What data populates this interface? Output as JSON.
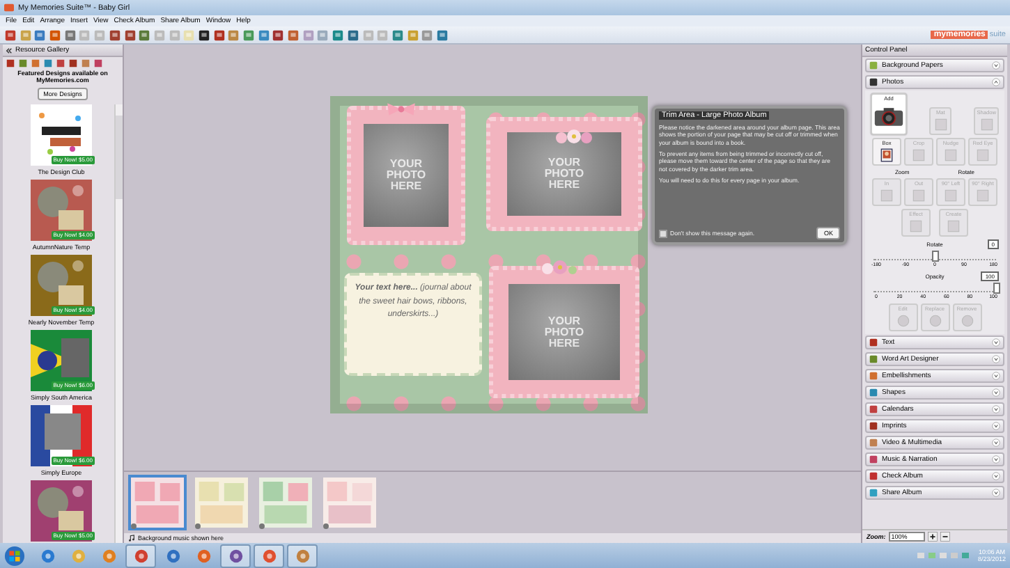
{
  "window": {
    "title": "My Memories Suite™ - Baby Girl"
  },
  "menu": [
    "File",
    "Edit",
    "Arrange",
    "Insert",
    "View",
    "Check Album",
    "Share Album",
    "Window",
    "Help"
  ],
  "logo": {
    "name": "mymemories",
    "suffix": "suite"
  },
  "gallery": {
    "title": "Resource Gallery",
    "featured": "Featured Designs available on MyMemories.com",
    "more_button": "More Designs",
    "items": [
      {
        "name": "The Design Club",
        "price": "Buy Now! $5.00"
      },
      {
        "name": "AutumnNature Temp",
        "price": "Buy Now! $4.00"
      },
      {
        "name": "Nearly November Temp",
        "price": "Buy Now! $4.00"
      },
      {
        "name": "Simply South America",
        "price": "Buy Now! $6.00"
      },
      {
        "name": "Simply Europe",
        "price": "Buy Now! $6.00"
      },
      {
        "price": "Buy Now! $5.00"
      }
    ]
  },
  "page": {
    "photo_placeholders": [
      "YOUR PHOTO HERE",
      "YOUR PHOTO HERE",
      "YOUR PHOTO HERE"
    ],
    "text_box": "**Your text here...** (journal about the sweet hair bows, ribbons, underskirts...)"
  },
  "dialog": {
    "title": "Trim Area - Large Photo Album",
    "paragraphs": [
      "Please notice the darkened area around your album page. This area shows the portion of your page that may be cut off or trimmed when your album is bound into a book.",
      "To prevent any items from being trimmed or incorrectly cut off, please move them toward the center of the page so that they are not covered by the darker trim area.",
      "You will need to do this for every page in your album."
    ],
    "checkbox": {
      "label": "Don't show this message again.",
      "checked": false
    },
    "ok_button": "OK"
  },
  "thumbnails": [
    {
      "selected": true
    },
    {
      "selected": false
    },
    {
      "selected": false
    },
    {
      "selected": false
    }
  ],
  "music_bar": "Background music shown here",
  "control_panel": {
    "title": "Control Panel",
    "top_sections": [
      {
        "label": "Background Papers",
        "expanded": false
      },
      {
        "label": "Photos",
        "expanded": true
      }
    ],
    "tool_rows": [
      {
        "buttons": [
          {
            "label": "Add",
            "kind": "large",
            "disabled": false
          },
          {
            "label": "Mat",
            "kind": "small",
            "disabled": true
          },
          {
            "label": "Shadow",
            "kind": "small",
            "disabled": true
          }
        ]
      },
      {
        "buttons": [
          {
            "label": "Box",
            "kind": "small",
            "disabled": false
          },
          {
            "label": "Crop",
            "kind": "small",
            "disabled": true
          },
          {
            "label": "Nudge",
            "kind": "small",
            "disabled": true
          },
          {
            "label": "Red Eye",
            "kind": "small",
            "disabled": true
          }
        ]
      },
      {
        "headings": [
          "Zoom",
          "Rotate"
        ]
      },
      {
        "buttons": [
          {
            "label": "In",
            "kind": "small",
            "disabled": true
          },
          {
            "label": "Out",
            "kind": "small",
            "disabled": true
          },
          {
            "label": "90° Left",
            "kind": "small",
            "disabled": true
          },
          {
            "label": "90° Right",
            "kind": "small",
            "disabled": true
          }
        ]
      },
      {
        "buttons": [
          {
            "label": "Effect",
            "kind": "small",
            "disabled": true
          },
          {
            "label": "Create",
            "kind": "small",
            "disabled": true
          }
        ]
      }
    ],
    "sliders": [
      {
        "label": "Rotate",
        "value": "0",
        "ticks": [
          "-180",
          "-90",
          "0",
          "90",
          "180"
        ],
        "level": 0.5
      },
      {
        "label": "Opacity",
        "value": "100",
        "ticks": [
          "0",
          "20",
          "40",
          "60",
          "80",
          "100"
        ],
        "level": 1
      }
    ],
    "action_buttons": [
      {
        "label": "Edit",
        "disabled": true
      },
      {
        "label": "Replace",
        "disabled": true
      },
      {
        "label": "Remove",
        "disabled": true
      }
    ],
    "sections": [
      {
        "label": "Text",
        "expanded": false
      },
      {
        "label": "Word Art Designer",
        "expanded": false
      },
      {
        "label": "Embellishments",
        "expanded": false
      },
      {
        "label": "Shapes",
        "expanded": false
      },
      {
        "label": "Calendars",
        "expanded": false
      },
      {
        "label": "Imprints",
        "expanded": false
      },
      {
        "label": "Video & Multimedia",
        "expanded": false
      },
      {
        "label": "Music & Narration",
        "expanded": false
      },
      {
        "label": "Check Album",
        "expanded": false
      },
      {
        "label": "Share Album",
        "expanded": false
      }
    ],
    "zoom_label": "Zoom:",
    "zoom_value": "100%"
  },
  "taskbar": {
    "apps": [
      {
        "running": false
      },
      {
        "running": false
      },
      {
        "running": false
      },
      {
        "running": true
      },
      {
        "running": false
      },
      {
        "running": false
      },
      {
        "running": true
      },
      {
        "running": true
      },
      {
        "running": true
      }
    ],
    "time": "10:06 AM",
    "date": "8/23/2012"
  }
}
